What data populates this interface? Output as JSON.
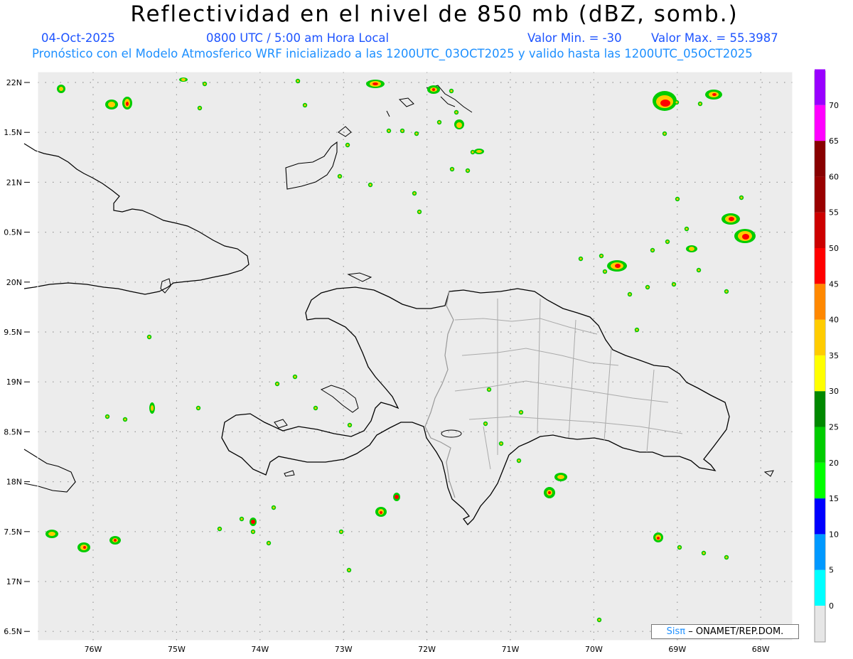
{
  "title": "Reflectividad en el nivel de 850 mb (dBZ, somb.)",
  "header": {
    "date": "04-Oct-2025",
    "time": "0800 UTC / 5:00 am Hora Local",
    "min": "Valor Min. = -30",
    "max": "Valor Max. = 55.3987",
    "model": "Pronóstico con el Modelo Atmosferico WRF inicializado a las 1200UTC_03OCT2025 y valido hasta las  1200UTC_05OCT2025"
  },
  "lat_labels": [
    "22N",
    "1.5N",
    "21N",
    "0.5N",
    "20N",
    "9.5N",
    "19N",
    "8.5N",
    "18N",
    "7.5N",
    "17N",
    "6.5N"
  ],
  "lon_labels": [
    "76W",
    "75W",
    "74W",
    "73W",
    "72W",
    "71W",
    "70W",
    "69W",
    "68W"
  ],
  "colorbar": {
    "labels": [
      "0",
      "5",
      "10",
      "15",
      "20",
      "25",
      "30",
      "35",
      "40",
      "45",
      "50",
      "55",
      "60",
      "65",
      "70"
    ],
    "colors": [
      "#00ffff",
      "#0099ff",
      "#0000ff",
      "#00ff00",
      "#00cc00",
      "#008800",
      "#ffff00",
      "#ffcc00",
      "#ff8800",
      "#ff0000",
      "#cc0000",
      "#990000",
      "#880000",
      "#ff00ff",
      "#9900ff"
    ]
  },
  "credit": {
    "logo": "Sisπ",
    "text": "– ONAMET/REP.DOM."
  }
}
